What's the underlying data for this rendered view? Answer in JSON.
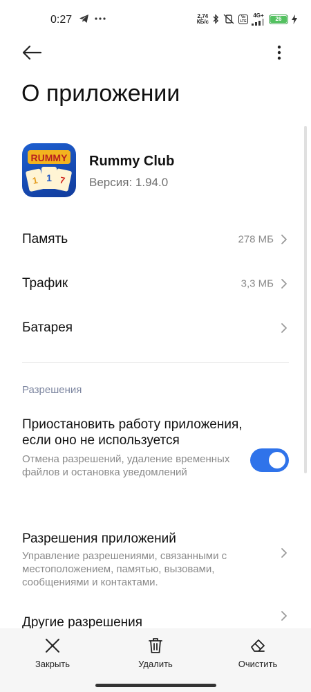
{
  "status_bar": {
    "time": "0:27",
    "speed_value": "2,74",
    "speed_unit": "КБ/с",
    "volte": "Vo LTE",
    "network": "4G+",
    "battery": "26"
  },
  "header": {
    "title": "О приложении"
  },
  "app": {
    "name": "Rummy Club",
    "version": "Версия: 1.94.0",
    "icon_label": "RUMMY"
  },
  "rows": [
    {
      "label": "Память",
      "value": "278 МБ"
    },
    {
      "label": "Трафик",
      "value": "3,3 МБ"
    },
    {
      "label": "Батарея",
      "value": ""
    }
  ],
  "permissions": {
    "section_title": "Разрешения",
    "pause_title": "Приостановить работу приложения, если оно не используется",
    "pause_sub": "Отмена разрешений, удаление временных файлов и остановка уведомлений",
    "pause_enabled": true,
    "app_perms_title": "Разрешения приложений",
    "app_perms_sub": "Управление разрешениями, связанными с местоположением, памятью, вызовами, сообщениями и контактами.",
    "other_perms_title": "Другие разрешения"
  },
  "bottom_bar": {
    "close_label": "Закрыть",
    "delete_label": "Удалить",
    "clear_label": "Очистить"
  },
  "colors": {
    "accent": "#2f73ea",
    "section": "#7d86a0"
  }
}
